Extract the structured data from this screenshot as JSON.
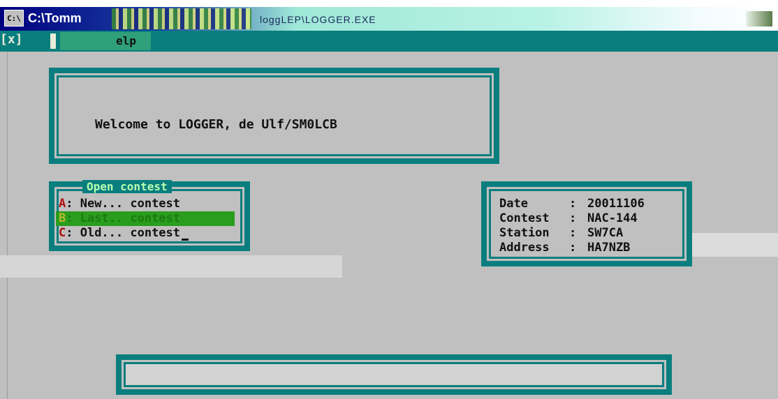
{
  "window": {
    "title_path": "C:\\Tomm",
    "exe_name": "loggLEP\\LOGGER.EXE",
    "system_menu_icon": "command-prompt-icon"
  },
  "menu": {
    "close_marker": "[x]",
    "help_label": "elp"
  },
  "welcome": {
    "message": "Welcome to LOGGER, de Ulf/SM0LCB"
  },
  "open_contest": {
    "title": "Open contest",
    "options": [
      {
        "key": "A",
        "label": ": New... contest",
        "selected": false
      },
      {
        "key": "B",
        "label": ": Last.. contest",
        "selected": true
      },
      {
        "key": "C",
        "label": ": Old... contest",
        "selected": false
      }
    ]
  },
  "info": {
    "rows": [
      {
        "label": "Date",
        "value": "20011106"
      },
      {
        "label": "Contest",
        "value": "NAC-144"
      },
      {
        "label": "Station",
        "value": "SW7CA"
      },
      {
        "label": "Address",
        "value": "HA7NZB"
      }
    ],
    "separator": ":"
  },
  "colors": {
    "teal": "#0a7e7e",
    "grey": "#c0c0c0",
    "highlight": "#2a9d1e",
    "hotkey": "#b01010"
  }
}
